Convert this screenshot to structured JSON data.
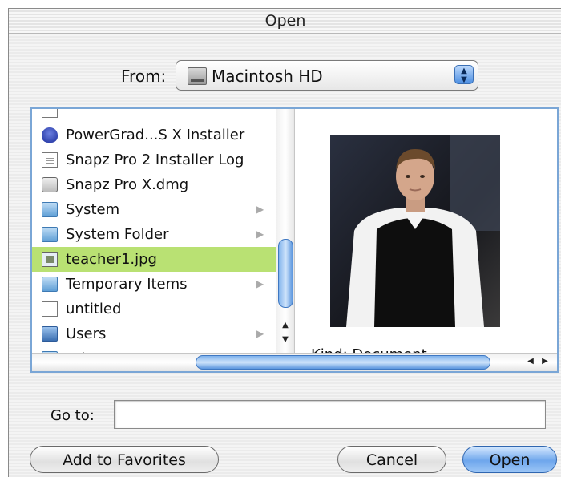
{
  "dialog": {
    "title": "Open"
  },
  "from": {
    "label": "From:",
    "selected": "Macintosh HD",
    "icon": "hard-disk-icon"
  },
  "file_list": [
    {
      "label": "PowerGrad...S X Installer",
      "icon": "installer-shield-icon",
      "has_arrow": false
    },
    {
      "label": "Snapz Pro 2 Installer Log",
      "icon": "document-icon",
      "has_arrow": false
    },
    {
      "label": "Snapz Pro X.dmg",
      "icon": "disk-image-icon",
      "has_arrow": false
    },
    {
      "label": "System",
      "icon": "folder-icon",
      "has_arrow": true
    },
    {
      "label": "System Folder",
      "icon": "system-folder-icon",
      "has_arrow": true
    },
    {
      "label": "teacher1.jpg",
      "icon": "jpeg-file-icon",
      "has_arrow": false,
      "selected": true
    },
    {
      "label": "Temporary Items",
      "icon": "folder-icon",
      "has_arrow": true
    },
    {
      "label": "untitled",
      "icon": "blank-document-icon",
      "has_arrow": false
    },
    {
      "label": "Users",
      "icon": "users-folder-icon",
      "has_arrow": true
    },
    {
      "label": "Yahoo! Messenger",
      "icon": "folder-icon",
      "has_arrow": true
    }
  ],
  "preview": {
    "kind_text": "Kind: Document"
  },
  "go_to": {
    "label": "Go to:",
    "value": ""
  },
  "buttons": {
    "add_favorites": "Add to Favorites",
    "cancel": "Cancel",
    "open": "Open"
  },
  "colors": {
    "selection": "#b9e173",
    "accent": "#6ea6ec",
    "scroll_thumb": "#7fb2ec"
  }
}
